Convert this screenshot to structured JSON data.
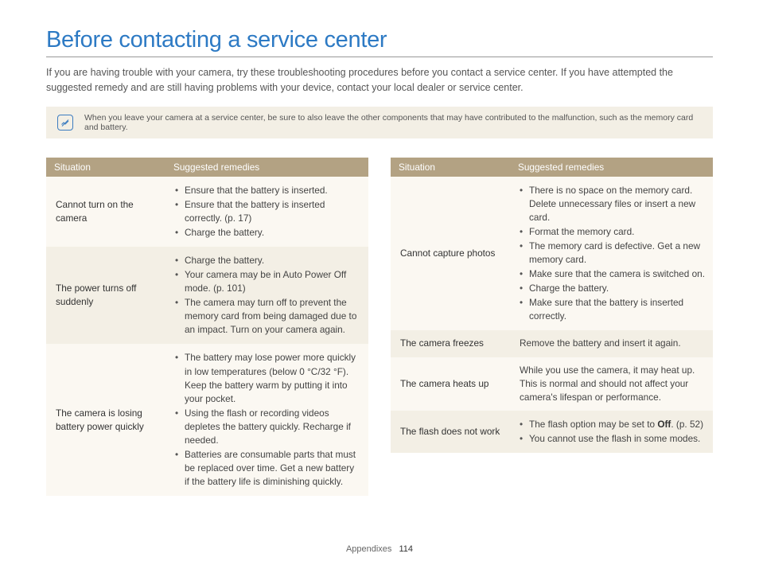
{
  "heading": "Before contacting a service center",
  "intro": "If you are having trouble with your camera, try these troubleshooting procedures before you contact a service center. If you have attempted the suggested remedy and are still having problems with your device, contact your local dealer or service center.",
  "note": "When you leave your camera at a service center, be sure to also leave the other components that may have contributed to the malfunction, such as the memory card and battery.",
  "headers": {
    "situation": "Situation",
    "remedies": "Suggested remedies"
  },
  "left": [
    {
      "situation": "Cannot turn on the camera",
      "remedies": [
        "Ensure that the battery is inserted.",
        "Ensure that the battery is inserted correctly. (p. 17)",
        "Charge the battery."
      ]
    },
    {
      "situation": "The power turns off suddenly",
      "remedies": [
        "Charge the battery.",
        "Your camera may be in Auto Power Off mode. (p. 101)",
        "The camera may turn off to prevent the memory card from being damaged due to an impact. Turn on your camera again."
      ]
    },
    {
      "situation": "The camera is losing battery power quickly",
      "remedies": [
        "The battery may lose power more quickly in low temperatures (below 0 °C/32 °F). Keep the battery warm by putting it into your pocket.",
        "Using the flash or recording videos depletes the battery quickly. Recharge if needed.",
        "Batteries are consumable parts that must be replaced over time. Get a new battery if the battery life is diminishing quickly."
      ]
    }
  ],
  "right": [
    {
      "situation": "Cannot capture photos",
      "remedies": [
        "There is no space on the memory card. Delete unnecessary files or insert a new card.",
        "Format the memory card.",
        "The memory card is defective. Get a new memory card.",
        "Make sure that the camera is switched on.",
        "Charge the battery.",
        "Make sure that the battery is inserted correctly."
      ]
    },
    {
      "situation": "The camera freezes",
      "plain": "Remove the battery and insert it again."
    },
    {
      "situation": "The camera heats up",
      "plain": "While you use the camera, it may heat up. This is normal and should not affect your camera's lifespan or performance."
    },
    {
      "situation": "The flash does not work",
      "remedies_html": [
        {
          "pre": "The flash option may be set to ",
          "bold": "Off",
          "post": ". (p. 52)"
        },
        {
          "pre": "You cannot use the flash in some modes.",
          "bold": "",
          "post": ""
        }
      ]
    }
  ],
  "footer": {
    "section": "Appendixes",
    "page": "114"
  }
}
